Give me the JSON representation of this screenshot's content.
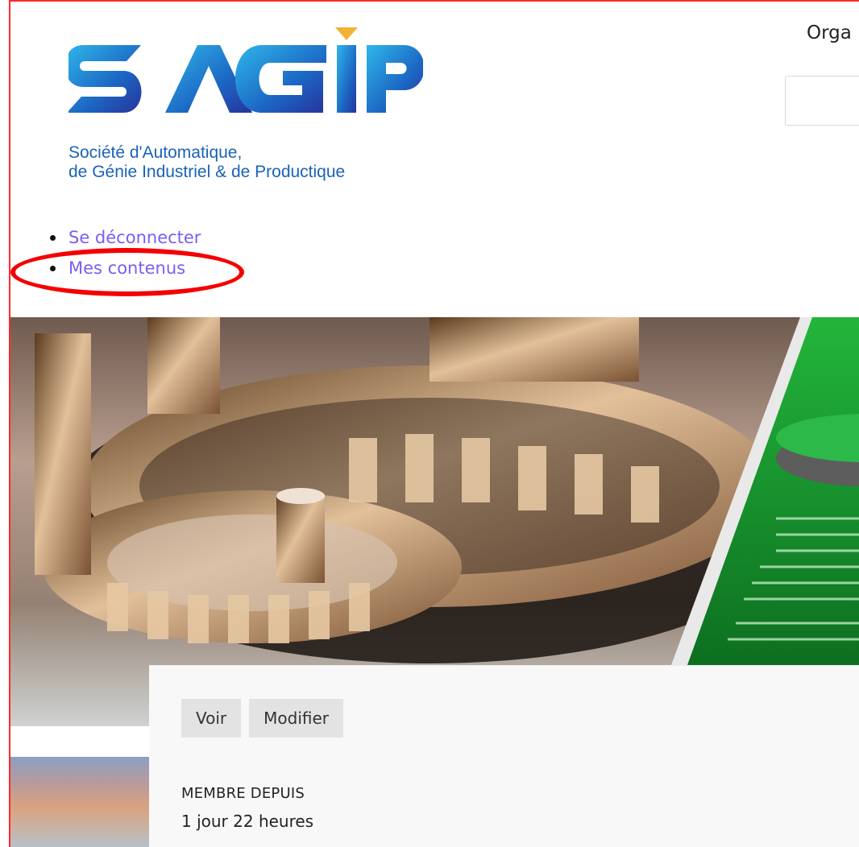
{
  "header": {
    "logo_text": "SAGIP",
    "tagline_line1": "Société d'Automatique,",
    "tagline_line2": "de Génie Industriel & de Productique",
    "org_text_partial": "Orga",
    "search_value": ""
  },
  "user_menu": {
    "items": [
      {
        "label": "Se déconnecter"
      },
      {
        "label": "Mes contenus"
      }
    ]
  },
  "profile": {
    "tabs": [
      {
        "label": "Voir"
      },
      {
        "label": "Modifier"
      }
    ],
    "member_since_label": "MEMBRE DEPUIS",
    "member_since_value": "1 jour 22 heures"
  },
  "colors": {
    "link": "#7c5cf0",
    "logo_blue": "#1a63b6",
    "logo_accent": "#f2b233",
    "annotation": "#f40000"
  }
}
